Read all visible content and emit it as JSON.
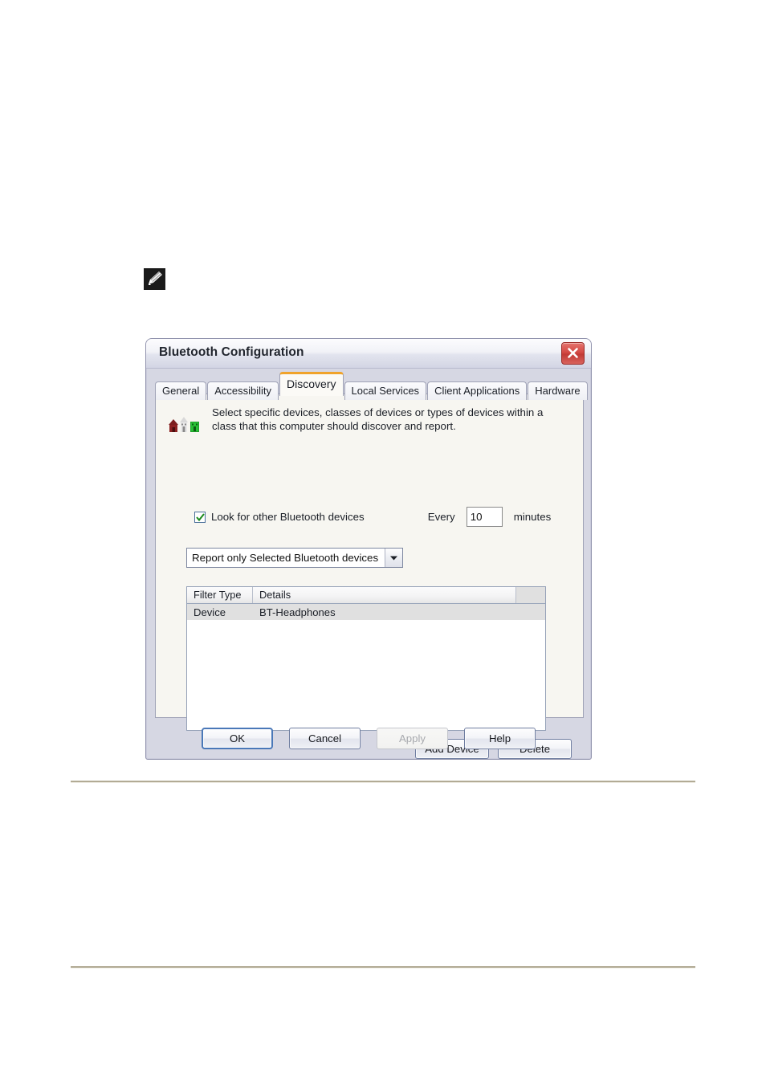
{
  "document": {
    "note_icon": "pencil-note-icon",
    "rules": [
      "horizontal-rule-top",
      "horizontal-rule-bottom"
    ]
  },
  "dialog": {
    "title": "Bluetooth Configuration",
    "close_button_label": "×",
    "tabs": [
      {
        "label": "General",
        "active": false
      },
      {
        "label": "Accessibility",
        "active": false
      },
      {
        "label": "Discovery",
        "active": true
      },
      {
        "label": "Local Services",
        "active": false
      },
      {
        "label": "Client Applications",
        "active": false
      },
      {
        "label": "Hardware",
        "active": false
      }
    ],
    "panel": {
      "icon": "buildings-devices-icon",
      "description": "Select specific devices, classes of devices or types of devices within a class that this computer should discover and report.",
      "checkbox": {
        "label": "Look for other Bluetooth devices",
        "checked": true
      },
      "interval": {
        "prefix_label": "Every",
        "value": "10",
        "suffix_label": "minutes"
      },
      "report_dropdown": {
        "selected": "Report only Selected Bluetooth devices",
        "arrow_icon": "chevron-down-icon"
      },
      "device_list": {
        "columns": [
          "Filter Type",
          "Details",
          ""
        ],
        "rows": [
          {
            "filter_type": "Device",
            "details": "BT-Headphones",
            "selected": true
          }
        ]
      },
      "buttons": {
        "add_device": "Add Device",
        "delete": "Delete"
      }
    },
    "footer_buttons": {
      "ok": "OK",
      "cancel": "Cancel",
      "apply": "Apply",
      "help": "Help"
    }
  },
  "colors": {
    "accent_tab": "#f0a32a",
    "close_button": "#d44a45",
    "default_button_border": "#4a78b8",
    "selection": "#e0e0e0",
    "rule": "#b2ab95"
  }
}
